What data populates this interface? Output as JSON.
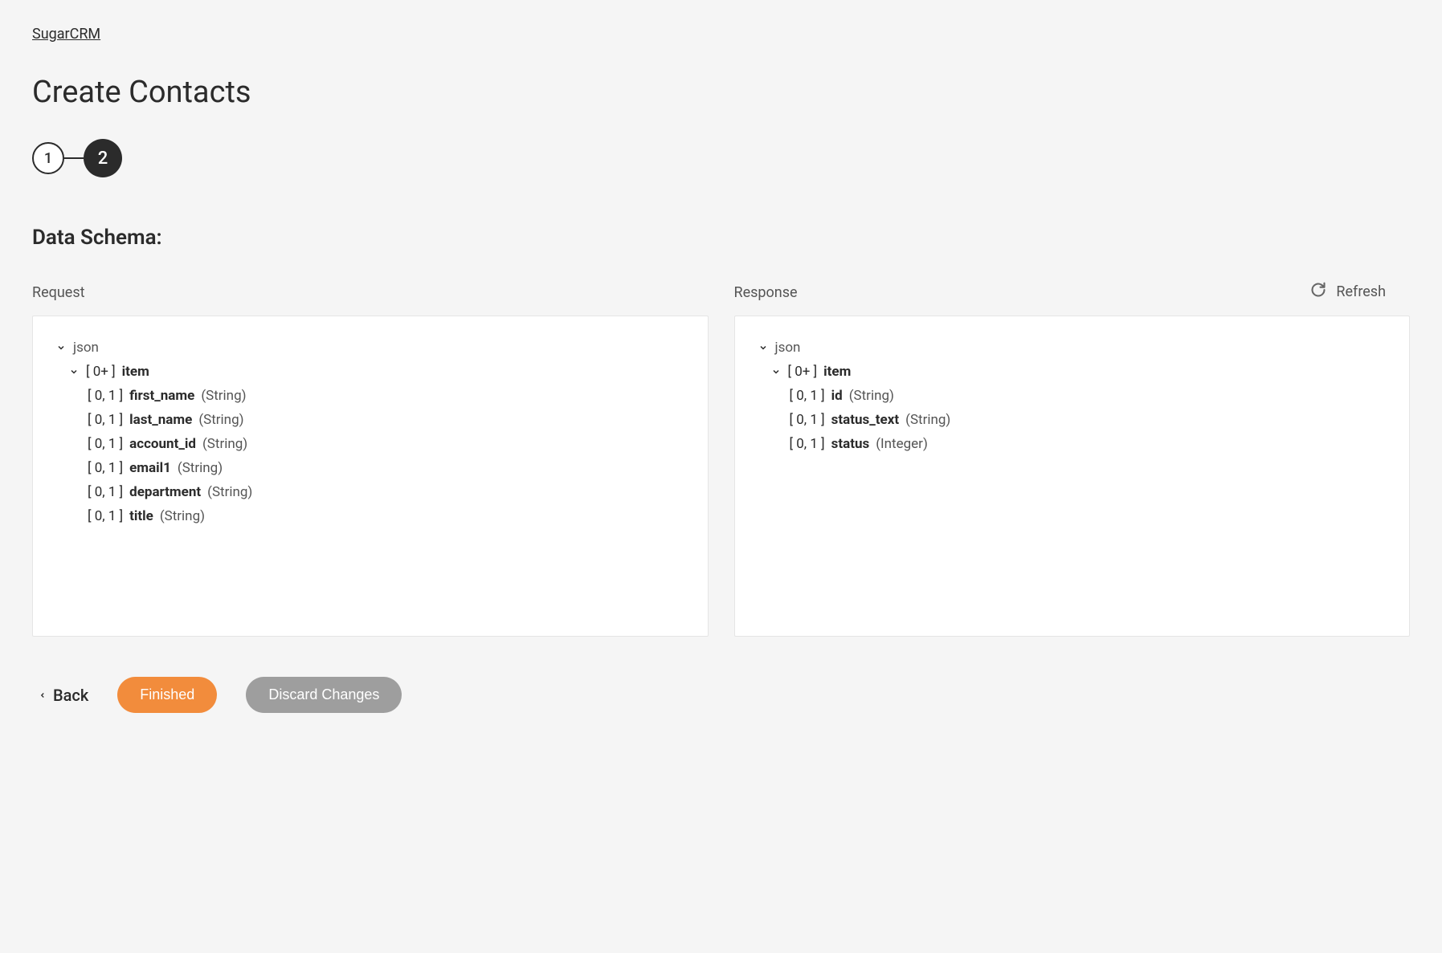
{
  "breadcrumb": "SugarCRM",
  "page_title": "Create Contacts",
  "stepper": {
    "step1": "1",
    "step2": "2"
  },
  "section_title": "Data Schema:",
  "refresh_label": "Refresh",
  "request": {
    "label": "Request",
    "root": "json",
    "item_cardinality": "[ 0+ ]",
    "item_name": "item",
    "fields": [
      {
        "cardinality": "[ 0, 1 ]",
        "name": "first_name",
        "type": "(String)"
      },
      {
        "cardinality": "[ 0, 1 ]",
        "name": "last_name",
        "type": "(String)"
      },
      {
        "cardinality": "[ 0, 1 ]",
        "name": "account_id",
        "type": "(String)"
      },
      {
        "cardinality": "[ 0, 1 ]",
        "name": "email1",
        "type": "(String)"
      },
      {
        "cardinality": "[ 0, 1 ]",
        "name": "department",
        "type": "(String)"
      },
      {
        "cardinality": "[ 0, 1 ]",
        "name": "title",
        "type": "(String)"
      }
    ]
  },
  "response": {
    "label": "Response",
    "root": "json",
    "item_cardinality": "[ 0+ ]",
    "item_name": "item",
    "fields": [
      {
        "cardinality": "[ 0, 1 ]",
        "name": "id",
        "type": "(String)"
      },
      {
        "cardinality": "[ 0, 1 ]",
        "name": "status_text",
        "type": "(String)"
      },
      {
        "cardinality": "[ 0, 1 ]",
        "name": "status",
        "type": "(Integer)"
      }
    ]
  },
  "footer": {
    "back": "Back",
    "finished": "Finished",
    "discard": "Discard Changes"
  }
}
